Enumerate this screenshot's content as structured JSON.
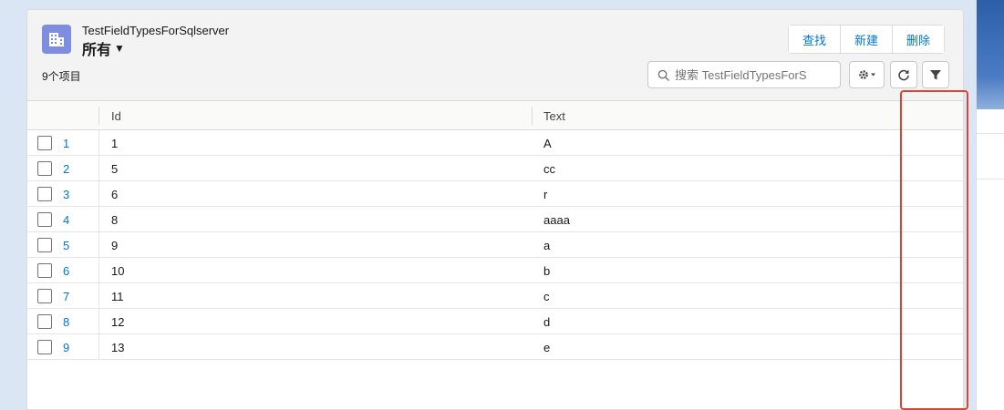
{
  "header": {
    "object_name": "TestFieldTypesForSqlserver",
    "list_view": "所有",
    "item_count": "9个项目"
  },
  "actions": {
    "find_label": "查找",
    "new_label": "新建",
    "delete_label": "删除"
  },
  "search": {
    "placeholder": "搜索 TestFieldTypesForS"
  },
  "table": {
    "columns": [
      "Id",
      "Text"
    ],
    "rows": [
      {
        "num": "1",
        "id": "1",
        "text": "A"
      },
      {
        "num": "2",
        "id": "5",
        "text": "cc"
      },
      {
        "num": "3",
        "id": "6",
        "text": "r"
      },
      {
        "num": "4",
        "id": "8",
        "text": "aaaa"
      },
      {
        "num": "5",
        "id": "9",
        "text": "a"
      },
      {
        "num": "6",
        "id": "10",
        "text": "b"
      },
      {
        "num": "7",
        "id": "11",
        "text": "c"
      },
      {
        "num": "8",
        "id": "12",
        "text": "d"
      },
      {
        "num": "9",
        "id": "13",
        "text": "e"
      }
    ]
  },
  "colors": {
    "accent": "#0176d3",
    "object_icon": "#7f8de1",
    "highlight": "#e0432f"
  }
}
